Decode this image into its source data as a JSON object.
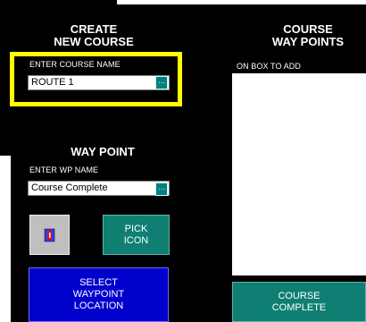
{
  "create_course": {
    "heading_line1": "CREATE",
    "heading_line2": "NEW COURSE",
    "course_name_label": "ENTER COURSE NAME",
    "course_name_value": "ROUTE 1",
    "browse_label": "..."
  },
  "waypoints_panel": {
    "heading_line1": "COURSE",
    "heading_line2": "WAY POINTS",
    "hint": "ON BOX TO ADD"
  },
  "way_point": {
    "heading": "WAY POINT",
    "wp_name_label": "ENTER WP NAME",
    "wp_name_value": "Course Complete",
    "browse_label": "...",
    "icon": "waypoint-marker-icon",
    "pick_icon_label_1": "PICK",
    "pick_icon_label_2": "ICON",
    "select_location_1": "SELECT",
    "select_location_2": "WAYPOINT",
    "select_location_3": "LOCATION"
  },
  "course_complete": {
    "label_1": "COURSE",
    "label_2": "COMPLETE"
  },
  "colors": {
    "highlight": "#ffff00",
    "teal_button": "#0f7f73",
    "blue_button": "#0000cc"
  }
}
